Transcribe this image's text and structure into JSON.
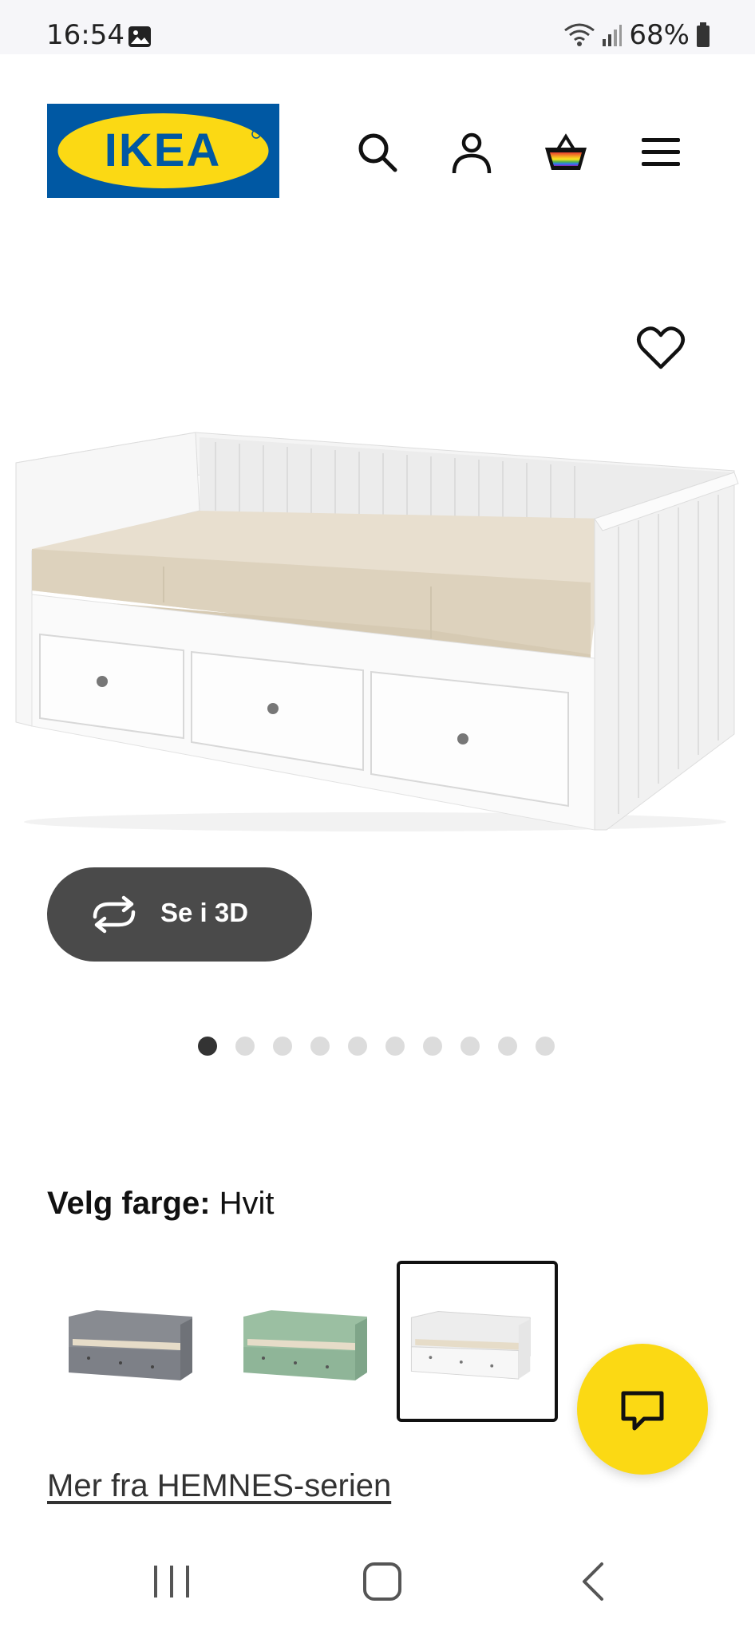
{
  "status_bar": {
    "time": "16:54",
    "battery": "68%",
    "icons": [
      "image-icon",
      "wifi-icon",
      "signal-icon",
      "battery-icon"
    ]
  },
  "header": {
    "logo_text": "IKEA",
    "icons": [
      "search-icon",
      "account-icon",
      "cart-icon",
      "menu-icon"
    ]
  },
  "product": {
    "view_3d_label": "Se i 3D",
    "carousel": {
      "total": 10,
      "active_index": 0
    },
    "color_label": "Velg farge:",
    "color_value": "Hvit",
    "swatches": [
      {
        "name": "Grå",
        "selected": false,
        "color": "#7d8087"
      },
      {
        "name": "Grønn",
        "selected": false,
        "color": "#8fb598"
      },
      {
        "name": "Hvit",
        "selected": true,
        "color": "#f2f2f2"
      }
    ],
    "series_link": "Mer fra HEMNES-serien"
  },
  "colors": {
    "ikea_blue": "#0058a3",
    "ikea_yellow": "#fbd914",
    "button_dark": "#4a4a4a"
  },
  "nav_bar": {
    "icons": [
      "recent-apps-icon",
      "home-icon",
      "back-icon"
    ]
  }
}
